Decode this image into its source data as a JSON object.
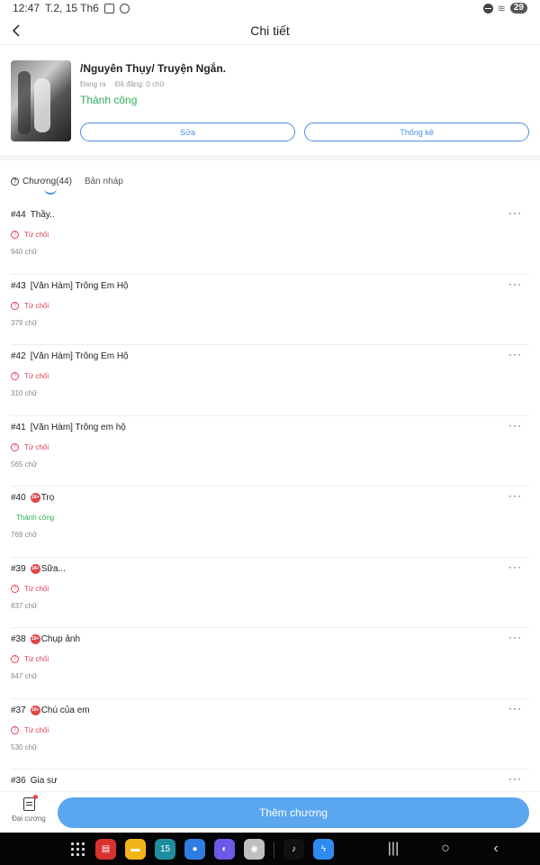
{
  "status_bar": {
    "time": "12:47",
    "date": "T.2, 15 Th6",
    "battery": "29"
  },
  "header": {
    "title": "Chi tiết"
  },
  "story": {
    "title": "/Nguyên Thụy/ Truyện Ngắn.",
    "state": "Đang ra",
    "posted": "Đã đăng: 0 chữ",
    "status": "Thành công",
    "edit_label": "Sửa",
    "stats_label": "Thống kê"
  },
  "tabs": [
    {
      "label": "Chương(44)",
      "active": true
    },
    {
      "label": "Bản nháp",
      "active": false
    }
  ],
  "chapters": [
    {
      "num": "#44",
      "title": "Thầy..",
      "adult": false,
      "status": "Từ chối",
      "status_type": "rejected",
      "words": "940 chữ"
    },
    {
      "num": "#43",
      "title": "[Văn Hàm] Trông Em Hộ",
      "adult": false,
      "status": "Từ chối",
      "status_type": "rejected",
      "words": "379 chữ"
    },
    {
      "num": "#42",
      "title": "[Văn Hàm] Trông Em Hộ",
      "adult": false,
      "status": "Từ chối",
      "status_type": "rejected",
      "words": "310 chữ"
    },
    {
      "num": "#41",
      "title": "[Văn Hàm] Trông em hộ",
      "adult": false,
      "status": "Từ chối",
      "status_type": "rejected",
      "words": "565 chữ"
    },
    {
      "num": "#40",
      "title": "Trọ",
      "adult": true,
      "status": "Thành công",
      "status_type": "success",
      "words": "769 chữ"
    },
    {
      "num": "#39",
      "title": "Sữa...",
      "adult": true,
      "status": "Từ chối",
      "status_type": "rejected",
      "words": "837 chữ"
    },
    {
      "num": "#38",
      "title": "Chụp ảnh",
      "adult": true,
      "status": "Từ chối",
      "status_type": "rejected",
      "words": "847 chữ"
    },
    {
      "num": "#37",
      "title": "Chú của em",
      "adult": true,
      "status": "Từ chối",
      "status_type": "rejected",
      "words": "530 chữ"
    },
    {
      "num": "#36",
      "title": "Gia sư",
      "adult": false,
      "status": "",
      "status_type": "",
      "words": ""
    }
  ],
  "bottom": {
    "outline_label": "Đại cương",
    "add_chapter_label": "Thêm chương"
  },
  "colors": {
    "accent": "#4a90e2",
    "primary_button": "#5aa7ef",
    "success": "#2eae56",
    "rejected": "#e0405a"
  },
  "nav_apps": [
    {
      "icon": "notes-app-icon",
      "color": "#d8322f",
      "glyph": "▤"
    },
    {
      "icon": "folder-app-icon",
      "color": "#f1b51a",
      "glyph": "▬"
    },
    {
      "icon": "calendar-app-icon",
      "color": "#1f8c9e",
      "glyph": "15"
    },
    {
      "icon": "messages-app-icon",
      "color": "#2f7de1",
      "glyph": "●"
    },
    {
      "icon": "browser-app-icon",
      "color": "#6b5ae6",
      "glyph": "◐"
    },
    {
      "icon": "camera-app-icon",
      "color": "#bfbfbf",
      "glyph": "◉"
    },
    {
      "icon": "tiktok-app-icon",
      "color": "#111111",
      "glyph": "♪"
    },
    {
      "icon": "messenger-app-icon",
      "color": "#2e8bf0",
      "glyph": "ϟ"
    }
  ]
}
